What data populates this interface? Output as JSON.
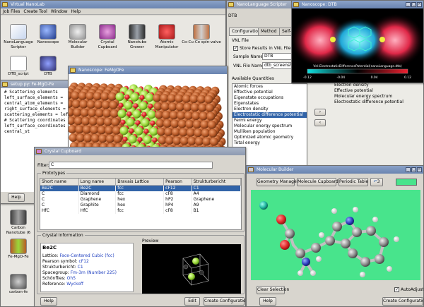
{
  "launcher": {
    "title": "Virtual NanoLab",
    "menu": [
      "Job Files",
      "Create Tool",
      "Window",
      "Help"
    ],
    "icons": [
      {
        "label": "NanoLanguage Scripter",
        "icon": "scripter-icon"
      },
      {
        "label": "Nanoscope",
        "icon": "nanoscope-icon"
      },
      {
        "label": "Molecular Builder",
        "icon": "molecular-builder-icon"
      },
      {
        "label": "Crystal Cupboard",
        "icon": "crystal-cupboard-icon"
      },
      {
        "label": "Nanotube Grower",
        "icon": "nanotube-grower-icon"
      },
      {
        "label": "Atomic Manipulator",
        "icon": "atomic-manipulator-icon"
      },
      {
        "label": "Co-Cu-Co spin-valve",
        "icon": "spin-valve-icon"
      },
      {
        "label": "DTB_script",
        "icon": "script-file-icon"
      },
      {
        "label": "DTB",
        "icon": "dtb-icon"
      }
    ],
    "side_icons": [
      {
        "label": "Carbon Nanotube (6",
        "icon": "nanotube-icon"
      },
      {
        "label": "Fe-MgO-Fe",
        "icon": "structure-icon"
      },
      {
        "label": "carbon-fe",
        "icon": "structure-icon"
      }
    ],
    "help": "Help"
  },
  "editor": {
    "title": "setup.py: Fe-MgO-Fe",
    "code": [
      "# Scattering elements",
      "left_surface_elements =",
      "central_atom_elements =",
      "",
      "right_surface_elements =",
      "scattering_elements = left",
      "",
      "# Scattering coordinates",
      "left_surface_coordinates",
      "",
      "central_st"
    ]
  },
  "scripter": {
    "title": "NanoLanguage Scripter",
    "subtitle": "DTB",
    "tabs": [
      "Configuration",
      "Method",
      "Self-C"
    ],
    "vnl_file_label": "VNL File",
    "store_checkbox": "Store Results in VNL File",
    "sample_name_label": "Sample Name:",
    "sample_name_value": "DTB",
    "vnl_file_name_label": "VNL File Name:",
    "vnl_file_name_value": "dtb_screenshot",
    "available_label": "Available Quantities",
    "available": [
      "Atomic forces",
      "Effective potential",
      "Eigenstate occupations",
      "Eigenstates",
      "Electron density",
      "Electrostatic difference potential",
      "Fermi energy",
      "Molecular energy spectrum",
      "Mulliken population",
      "Optimized atomic geometry",
      "Total energy"
    ],
    "available_selected": 5,
    "chosen": [
      "Electron density",
      "Effective potential",
      "Molecular energy spectrum",
      "Electrostatic difference potential"
    ],
    "arrow_add": "›",
    "arrow_remove": "‹"
  },
  "nanoscope_dtb": {
    "title": "Nanoscope: DTB",
    "colorbar_caption": "Vnl.ElectrostaticDifferencePotential(nanoLanguage.dtb)",
    "colorbar_ticks": [
      "-0.12",
      "-0.04",
      "0.04",
      "0.12"
    ]
  },
  "nanoscope_fe": {
    "title": "Nanoscope: FeMgOFe"
  },
  "crystal": {
    "title": "Crystal Cupboard",
    "filter_label": "Filter:",
    "filter_value": "C",
    "prototypes_label": "Prototypes",
    "columns": [
      "Short name",
      "Long name",
      "Bravais Lattice",
      "Pearson",
      "Strukturbericht"
    ],
    "rows": [
      [
        "Be2C",
        "Be2C",
        "fcc",
        "cF12",
        "C1"
      ],
      [
        "C",
        "Diamond",
        "fcc",
        "cF8",
        "A4"
      ],
      [
        "C",
        "Graphene",
        "hex",
        "hP2",
        "Graphene"
      ],
      [
        "C",
        "Graphite",
        "hex",
        "hP4",
        "A9"
      ],
      [
        "HfC",
        "HfC",
        "fcc",
        "cF8",
        "B1"
      ]
    ],
    "selected_row": 0,
    "info_label": "Crystal Information",
    "info_title": "Be2C",
    "info_lines": [
      {
        "k": "Lattice:",
        "v": "Face-Centered Cubic (fcc)"
      },
      {
        "k": "Pearson symbol:",
        "v": "cF12"
      },
      {
        "k": "Strukturbericht:",
        "v": "C1"
      },
      {
        "k": "Spacegroup:",
        "v": "Fm-3m (Number 225)"
      },
      {
        "k": "Schönflies:",
        "v": "Oh5"
      },
      {
        "k": "Reference:",
        "v": "Wyckoff"
      }
    ],
    "preview_label": "Preview",
    "help": "Help",
    "edit": "Edit",
    "create": "Create Configuration"
  },
  "molbuilder": {
    "title": "Molecular Builder",
    "toolbar": [
      "Geometry Manager",
      "Molecule Cupboard",
      "Periodic Table"
    ],
    "count": "3",
    "clear": "Clear Selection",
    "autoadjust": "AutoAdjust",
    "help": "Help",
    "create": "Create Configuration"
  },
  "colors": {
    "accent": "#3264a8",
    "fe": "#b85a28",
    "mgo": "#9ad83a",
    "oxygen": "#e02a2a",
    "canvas_green": "#48e48c",
    "canvas_black": "#000000"
  }
}
